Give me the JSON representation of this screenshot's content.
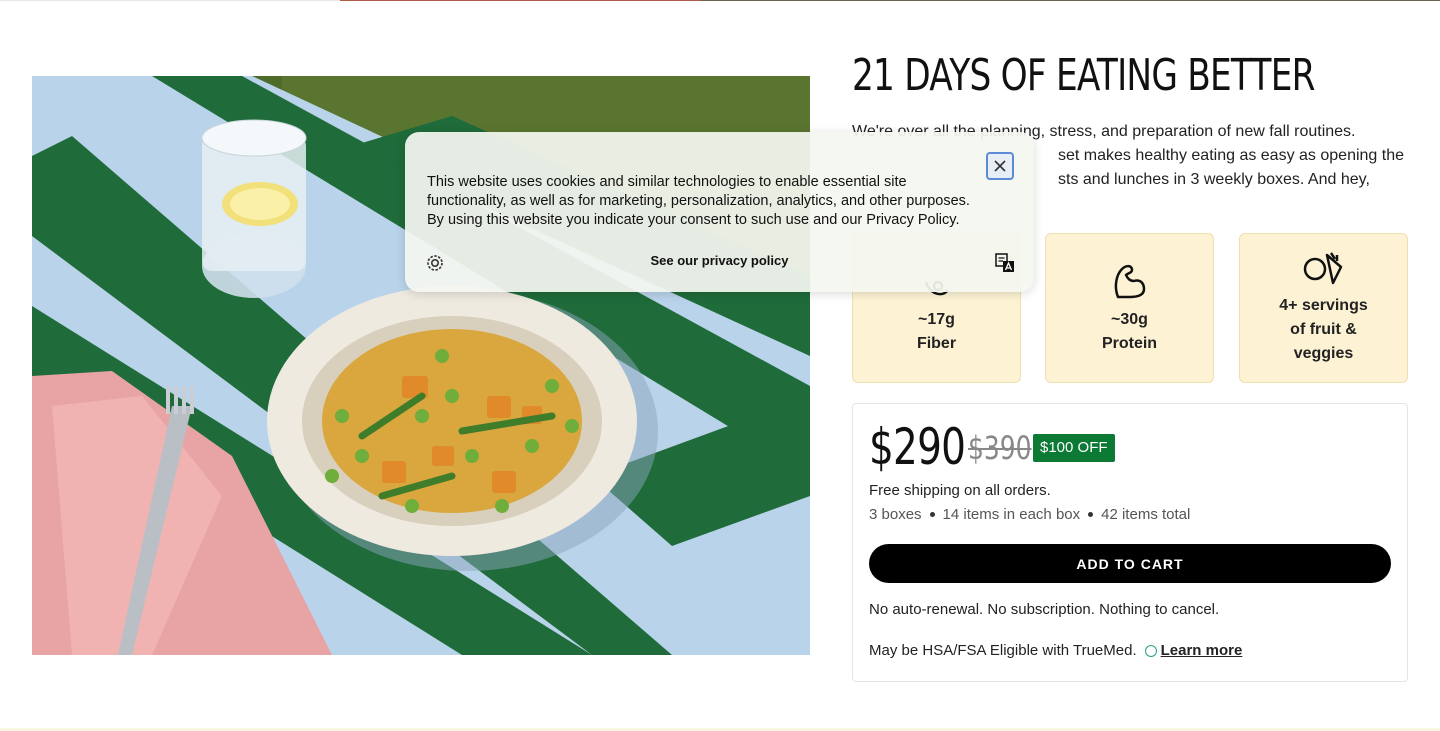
{
  "product": {
    "title": "21 DAYS OF EATING BETTER",
    "description": "We're over all the planning, stress, and preparation of new fall routines. ___ set makes healthy eating as easy as opening the ___ sts and lunches in 3 weekly boxes. And hey,",
    "desc_line1": "We're over all the planning, stress, and preparation of new fall routines.",
    "desc_line2": "set makes healthy eating as easy as opening the",
    "desc_line3": "sts and lunches in 3 weekly boxes. And hey,"
  },
  "stats": [
    {
      "icon": "fiber-icon",
      "line1": "~17g",
      "line2": "Fiber"
    },
    {
      "icon": "muscle-icon",
      "line1": "~30g",
      "line2": "Protein"
    },
    {
      "icon": "vegetables-icon",
      "line1": "4+ servings",
      "line2": "of fruit &",
      "line3": "veggies"
    }
  ],
  "pricing": {
    "price": "$290",
    "old_price": "$390",
    "discount_badge": "$100 OFF",
    "shipping": "Free shipping on all orders.",
    "meta": [
      "3 boxes",
      "14 items in each box",
      "42 items total"
    ],
    "add_to_cart": "ADD TO CART",
    "no_renewal": "No auto-renewal. No subscription. Nothing to cancel.",
    "hsa_text": "May be HSA/FSA Eligible with TrueMed.",
    "learn_more": "Learn more"
  },
  "cookie_banner": {
    "text_line1": "This website uses cookies and similar technologies to enable essential site",
    "text_line2": "functionality, as well as for marketing, personalization, analytics, and other purposes.",
    "text_line3": "By using this website you indicate your consent to such use and our Privacy Policy.",
    "policy_link": "See our privacy policy"
  },
  "colors": {
    "badge_green": "#0c7a35",
    "stat_bg": "#fdf3d4",
    "button_black": "#000000"
  }
}
